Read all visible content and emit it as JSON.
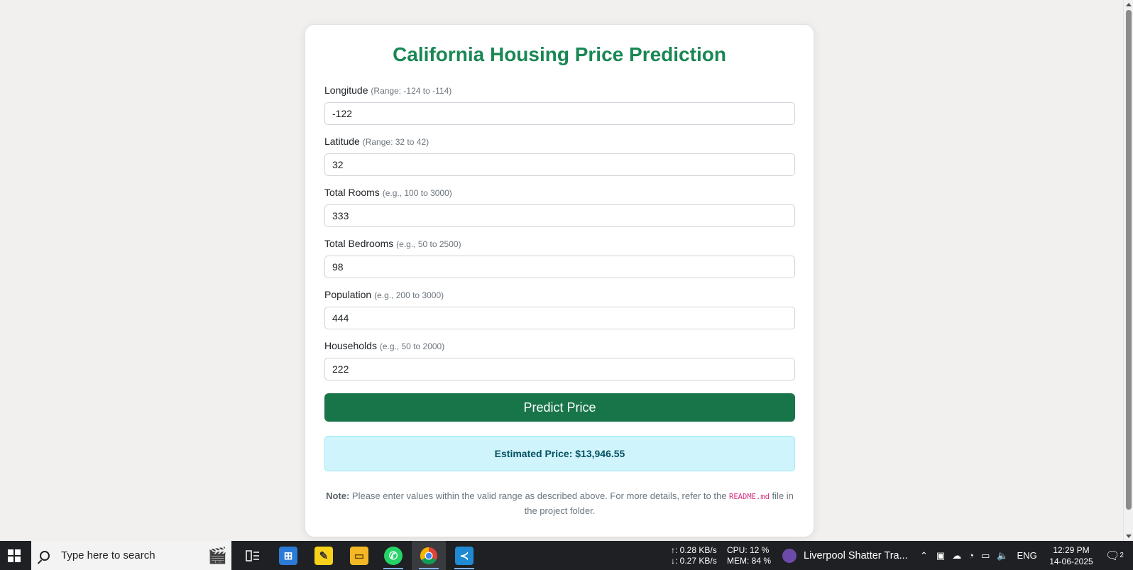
{
  "page": {
    "title": "California Housing Price Prediction",
    "fields": [
      {
        "label": "Longitude",
        "hint": "(Range: -124 to -114)",
        "value": "-122"
      },
      {
        "label": "Latitude",
        "hint": "(Range: 32 to 42)",
        "value": "32"
      },
      {
        "label": "Total Rooms",
        "hint": "(e.g., 100 to 3000)",
        "value": "333"
      },
      {
        "label": "Total Bedrooms",
        "hint": "(e.g., 50 to 2500)",
        "value": "98"
      },
      {
        "label": "Population",
        "hint": "(e.g., 200 to 3000)",
        "value": "444"
      },
      {
        "label": "Households",
        "hint": "(e.g., 50 to 2000)",
        "value": "222"
      }
    ],
    "predict_button": "Predict Price",
    "result": "Estimated Price: $13,946.55",
    "note": {
      "bold": "Note:",
      "before": " Please enter values within the valid range as described above. For more details, refer to the ",
      "code": "README.md",
      "after": " file in the project folder."
    },
    "accent_color": "#198754"
  },
  "taskbar": {
    "search_placeholder": "Type here to search",
    "net_up": "↑: 0.28 KB/s",
    "net_down": "↓: 0.27 KB/s",
    "cpu": "CPU: 12 %",
    "mem": "MEM: 84 %",
    "media_title": "Liverpool Shatter Tra...",
    "lang": "ENG",
    "time": "12:29 PM",
    "date": "14-06-2025",
    "notif_count": "2",
    "apps": [
      "task-view-icon",
      "microsoft-store-icon",
      "sticky-notes-icon",
      "file-explorer-icon",
      "whatsapp-icon",
      "chrome-icon",
      "vscode-icon"
    ]
  }
}
